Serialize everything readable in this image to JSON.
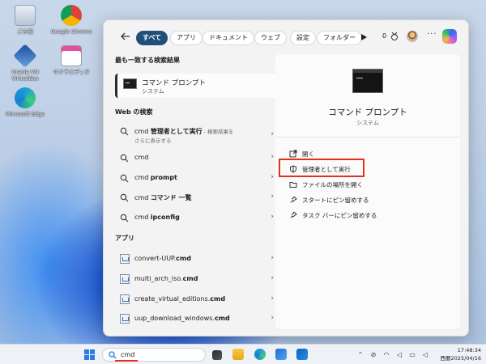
{
  "desktop": {
    "icons": [
      {
        "label": "ごみ箱",
        "icon": "recycle-bin-icon"
      },
      {
        "label": "Google Chrome",
        "icon": "chrome-icon"
      },
      {
        "label": "Oracle VM VirtualBox",
        "icon": "virtualbox-icon"
      },
      {
        "label": "サクラエディタ",
        "icon": "sakura-editor-icon"
      },
      {
        "label": "Microsoft Edge",
        "icon": "edge-icon"
      }
    ]
  },
  "filters": {
    "tabs": [
      {
        "label": "すべて",
        "active": true
      },
      {
        "label": "アプリ"
      },
      {
        "label": "ドキュメント"
      },
      {
        "label": "ウェブ"
      },
      {
        "label": "設定"
      },
      {
        "label": "フォルダー"
      }
    ],
    "points": "0"
  },
  "best_match": {
    "section_title": "最も一致する検索結果",
    "title": "コマンド プロンプト",
    "subtitle": "システム"
  },
  "web": {
    "section_title": "Web の検索",
    "items": [
      {
        "prefix": "cmd ",
        "bold": "管理者として実行",
        "hint": " - 検索結果を",
        "hint2": "さらに表示する"
      },
      {
        "prefix": "cmd",
        "bold": ""
      },
      {
        "prefix": "cmd ",
        "bold": "prompt"
      },
      {
        "prefix": "cmd ",
        "bold": "コマンド 一覧"
      },
      {
        "prefix": "cmd ",
        "bold": "ipconfig"
      }
    ]
  },
  "apps": {
    "section_title": "アプリ",
    "items": [
      {
        "name": "convert-UUP.",
        "ext": "cmd"
      },
      {
        "name": "multi_arch_iso.",
        "ext": "cmd"
      },
      {
        "name": "create_virtual_editions.",
        "ext": "cmd"
      },
      {
        "name": "uup_download_windows.",
        "ext": "cmd"
      }
    ]
  },
  "detail": {
    "title": "コマンド プロンプト",
    "subtitle": "システム",
    "actions": [
      {
        "label": "開く",
        "icon": "open-icon"
      },
      {
        "label": "管理者として実行",
        "icon": "shield-admin-icon",
        "highlighted": true
      },
      {
        "label": "ファイルの場所を開く",
        "icon": "folder-icon"
      },
      {
        "label": "スタートにピン留めする",
        "icon": "pin-icon"
      },
      {
        "label": "タスク バーにピン留めする",
        "icon": "pin-icon"
      }
    ]
  },
  "taskbar": {
    "search_query": "cmd",
    "time": "17:48:34",
    "date": "西暦2025/04/16",
    "apps": [
      "task-view-icon",
      "file-explorer-icon",
      "edge-icon",
      "store-icon",
      "outlook-icon"
    ]
  },
  "colors": {
    "accent": "#1f4f7a",
    "highlight_box": "#e0321e"
  }
}
